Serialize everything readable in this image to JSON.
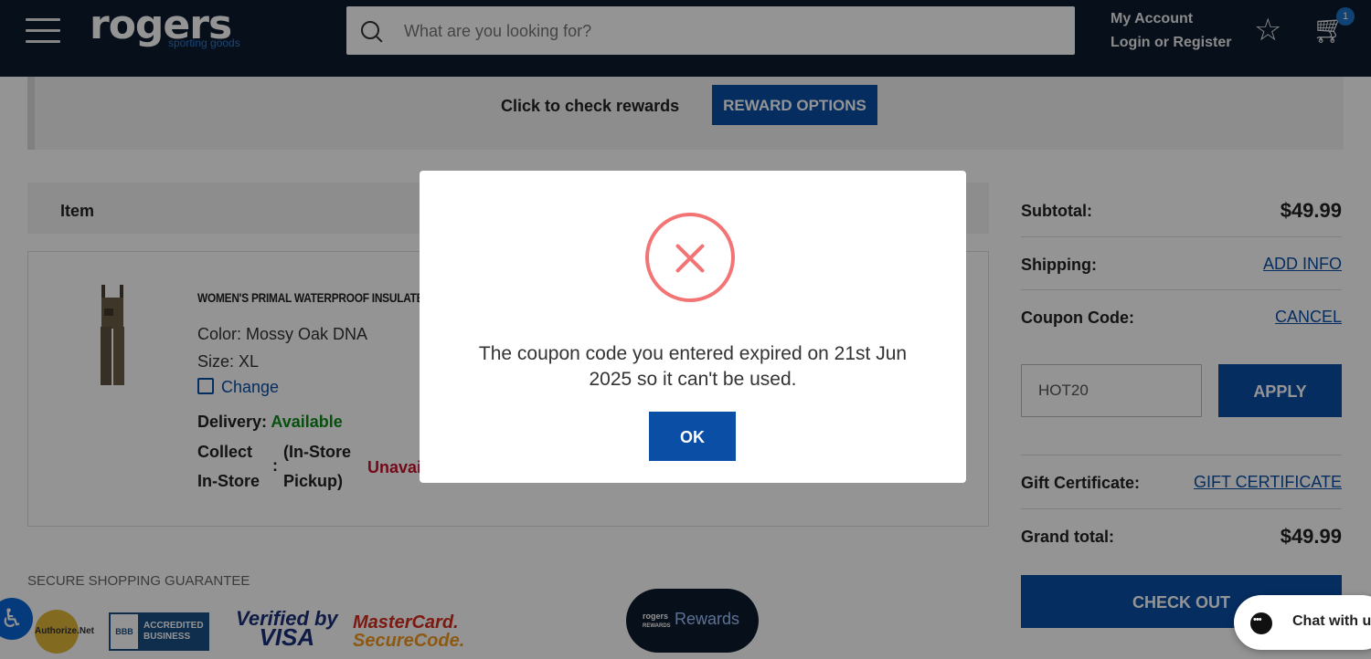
{
  "header": {
    "logo_text": "rogers",
    "logo_subtext": "sporting goods",
    "search_placeholder": "What are you looking for?",
    "account_title": "My Account",
    "account_link": "Login or Register",
    "cart_count": "1"
  },
  "rewards": {
    "prompt": "Click to check rewards",
    "button": "REWARD OPTIONS"
  },
  "items": {
    "header_label": "Item",
    "product": {
      "name": "WOMEN'S PRIMAL WATERPROOF INSULATED",
      "color_label": "Color:",
      "color_value": "Mossy Oak DNA",
      "size_label": "Size:",
      "size_value": "XL",
      "change_label": "Change",
      "delivery_label": "Delivery:",
      "delivery_status": "Available",
      "collect_label_1": "Collect",
      "collect_label_2": "In-Store",
      "collect_colon": ":",
      "collect_type_1": "(In-Store",
      "collect_type_2": "Pickup)",
      "collect_status": "Unavai"
    }
  },
  "footer": {
    "secure_label": "SECURE SHOPPING GUARANTEE",
    "badge_authorize": "Authorize.Net",
    "badge_bbb_mark": "BBB",
    "badge_bbb_text_1": "ACCREDITED",
    "badge_bbb_text_2": "BUSINESS",
    "badge_visa_1": "Verified by",
    "badge_visa_2": "VISA",
    "badge_mc_1": "MasterCard.",
    "badge_mc_2": "SecureCode.",
    "rewards_pill_logo_1": "rogers",
    "rewards_pill_logo_2": "REWARDS",
    "rewards_pill_label": "Rewards",
    "chat_label": "Chat with u"
  },
  "summary": {
    "subtotal_label": "Subtotal:",
    "subtotal_value": "$49.99",
    "shipping_label": "Shipping:",
    "shipping_link": "ADD INFO",
    "coupon_label": "Coupon Code:",
    "coupon_link": "CANCEL",
    "coupon_value": "HOT20",
    "apply_label": "APPLY",
    "gift_label": "Gift Certificate:",
    "gift_link": "GIFT CERTIFICATE",
    "grand_label": "Grand total:",
    "grand_value": "$49.99",
    "checkout_label": "CHECK OUT"
  },
  "modal": {
    "message": "The coupon code you entered expired on 21st Jun 2025 so it can't be used.",
    "ok_label": "OK"
  },
  "colors": {
    "header_bg": "#0d1b2e",
    "primary_blue": "#0a4ea6",
    "available_green": "#0d8a1a",
    "unavailable_red": "#c8102e",
    "error_icon": "#f27474"
  }
}
